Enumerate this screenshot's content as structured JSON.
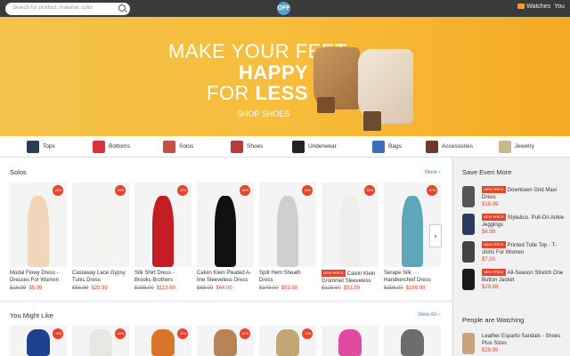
{
  "topbar": {
    "search_placeholder": "Search for product, material, color",
    "logo": "OFF",
    "watches_label": "Watches",
    "you_label": "You"
  },
  "hero": {
    "line1": "MAKE YOUR FEET",
    "line2": "HAPPY",
    "line3a": "FOR",
    "line3b": "LESS",
    "cta": "SHOP SHOES",
    "slide_count": 6,
    "active_slide": 3
  },
  "categories": [
    {
      "label": "Tops",
      "icon": "tops-icon",
      "color": "#2d3b57"
    },
    {
      "label": "Bottoms",
      "icon": "bottoms-icon",
      "color": "#d8323a"
    },
    {
      "label": "Solos",
      "icon": "solos-icon",
      "color": "#c44f47"
    },
    {
      "label": "Shoes",
      "icon": "shoes-icon",
      "color": "#b53a3a"
    },
    {
      "label": "Underwear",
      "icon": "underwear-icon",
      "color": "#222222"
    },
    {
      "label": "Bags",
      "icon": "bags-icon",
      "color": "#3c6fb8"
    },
    {
      "label": "Accessories",
      "icon": "accessories-icon",
      "color": "#6b3b26"
    },
    {
      "label": "Jewelry",
      "icon": "jewelry-icon",
      "color": "#c9b98c"
    }
  ],
  "solos": {
    "title": "Solos",
    "more_label": "More ›",
    "next_arrow": "›",
    "items": [
      {
        "name": "Modal Flowy Dress - Dresses For Women",
        "old": "$18.99",
        "price": "$5.99",
        "badge": "-69%",
        "color": "#f2d6b8",
        "new_price": false
      },
      {
        "name": "Castaway Lace Gypsy Tunic Dress",
        "old": "$58.99",
        "price": "$29.99",
        "badge": "-49%",
        "color": "#f5f3ef",
        "new_price": false
      },
      {
        "name": "Silk Shirt Dress - Brooks Brothers",
        "old": "$398.00",
        "price": "$119.60",
        "badge": "-70%",
        "color": "#c41e24",
        "new_price": false
      },
      {
        "name": "Calvin Klein Pleated A-line Sleeveless Dress",
        "old": "$88.00",
        "price": "$44.00",
        "badge": "-50%",
        "color": "#111111",
        "new_price": false
      },
      {
        "name": "Split Hem Sheath Dress",
        "old": "$148.00",
        "price": "$59.88",
        "badge": "-60%",
        "color": "#cfcfcf",
        "new_price": false
      },
      {
        "name": "Calvin Klein Grommet Sleeveless",
        "old": "$129.00",
        "price": "$53.99",
        "badge": "-58%",
        "color": "#eeeeea",
        "new_price": true
      },
      {
        "name": "Serape Silk Handkerchief Dress",
        "old": "$398.00",
        "price": "$169.99",
        "badge": "-57%",
        "color": "#5fa7b8",
        "new_price": false
      }
    ]
  },
  "might_like": {
    "title": "You Might Like",
    "view_all_label": "View All ›",
    "items": [
      {
        "color": "#1f3f8f",
        "badge": "-79%"
      },
      {
        "color": "#e8e6e1",
        "badge": "-40%"
      },
      {
        "color": "#d9752a",
        "badge": "-70%"
      },
      {
        "color": "#b58557",
        "badge": "-67%"
      },
      {
        "color": "#c4a675",
        "badge": "-72%"
      },
      {
        "color": "#e04ba0",
        "badge": ""
      },
      {
        "color": "#6d6d6d",
        "badge": ""
      }
    ]
  },
  "save_even_more": {
    "title": "Save Even More",
    "new_price_label": "NEW PRICE",
    "items": [
      {
        "name": "Downtown Grid Maxi Dress",
        "price": "$19.99",
        "color": "#555555"
      },
      {
        "name": "Style&co. Pull-On Ankle Jeggings",
        "price": "$6.99",
        "color": "#2d3c5c"
      },
      {
        "name": "Printed Tulle Top - T-shirts For Women",
        "price": "$7.00",
        "color": "#444444"
      },
      {
        "name": "All-Season Stretch One Button Jacket",
        "price": "$29.88",
        "color": "#1a1a1a"
      }
    ]
  },
  "people_watching": {
    "title": "People are Watching",
    "items": [
      {
        "name": "Leather Esparto Sandals - Shoes Plus Sizes",
        "price": "$29.99",
        "color": "#c8a27a"
      }
    ]
  }
}
